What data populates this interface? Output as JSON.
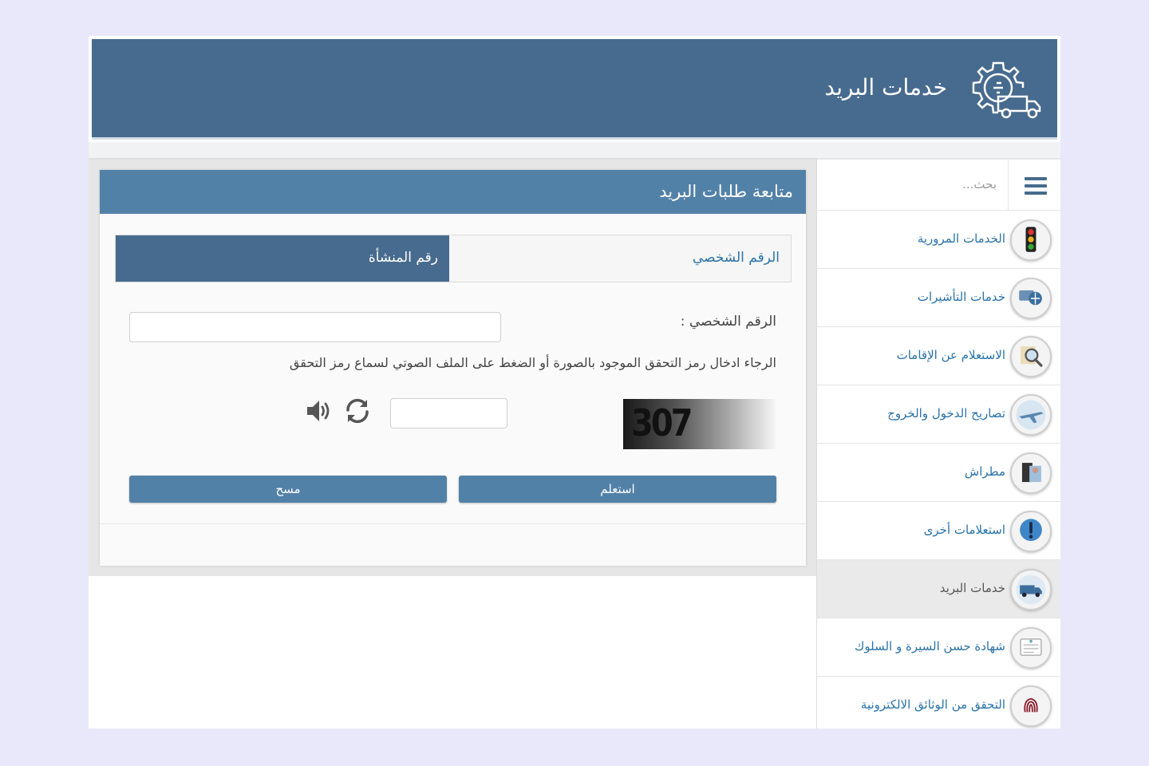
{
  "header": {
    "title": "خدمات البريد",
    "logo_icon": "gear-truck-icon"
  },
  "sidebar": {
    "search_placeholder": "بحث...",
    "items": [
      {
        "label": "الخدمات المرورية",
        "icon": "traffic-light-icon"
      },
      {
        "label": "خدمات التأشيرات",
        "icon": "visa-icon"
      },
      {
        "label": "الاستعلام عن الإقامات",
        "icon": "magnifier-icon"
      },
      {
        "label": "تصاريح الدخول والخروج",
        "icon": "airplane-icon"
      },
      {
        "label": "مطراش",
        "icon": "document-person-icon"
      },
      {
        "label": "استعلامات أخرى",
        "icon": "info-exclamation-icon"
      },
      {
        "label": "خدمات البريد",
        "icon": "delivery-truck-icon",
        "active": true
      },
      {
        "label": "شهادة حسن السيرة و السلوك",
        "icon": "certificate-icon"
      },
      {
        "label": "التحقق من الوثائق الالكترونية",
        "icon": "fingerprint-icon"
      }
    ]
  },
  "main": {
    "card_title": "متابعة طلبات البريد",
    "tabs": {
      "personal": "الرقم الشخصي",
      "facility": "رقم المنشأة"
    },
    "field_label": "الرقم الشخصي :",
    "hint": "الرجاء ادخال رمز التحقق الموجود بالصورة أو الضغط على الملف الصوتي لسماع رمز التحقق",
    "captcha_text": "307",
    "buttons": {
      "query": "استعلم",
      "clear": "مسح"
    }
  },
  "colors": {
    "header": "#476b8e",
    "card_header": "#5281a8",
    "link": "#2a73a8",
    "page_bg": "#e8e8fa"
  }
}
